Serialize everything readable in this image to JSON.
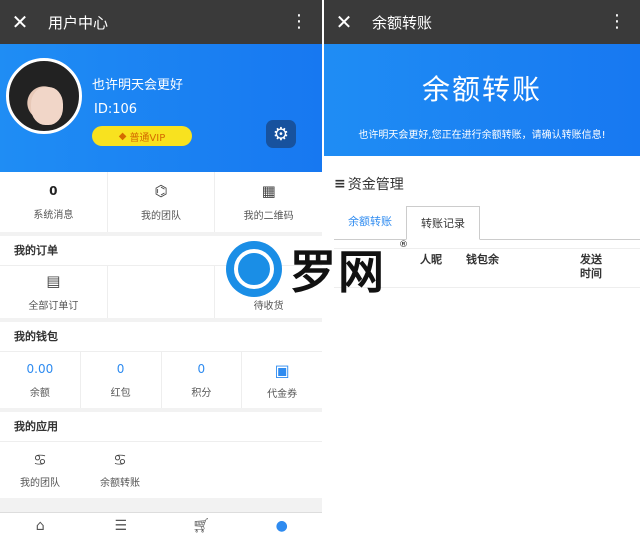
{
  "left": {
    "title": "用户中心",
    "profile": {
      "name": "也许明天会更好",
      "id": "ID:106",
      "vip": "普通VIP"
    },
    "stats": [
      {
        "value": "0",
        "label": "系统消息"
      },
      {
        "icon": "team-tree-icon",
        "label": "我的团队"
      },
      {
        "icon": "qrcode-icon",
        "label": "我的二维码"
      }
    ],
    "orders": {
      "title": "我的订单",
      "items": [
        "全部订单订",
        "",
        "待收货"
      ]
    },
    "wallet": {
      "title": "我的钱包",
      "items": [
        {
          "value": "0.00",
          "label": "余额"
        },
        {
          "value": "0",
          "label": "红包"
        },
        {
          "value": "0",
          "label": "积分"
        },
        {
          "icon": "voucher-icon",
          "label": "代金券"
        }
      ]
    },
    "apps": {
      "title": "我的应用",
      "items": [
        "我的团队",
        "余额转账"
      ]
    },
    "nav": [
      "home-icon",
      "list-icon",
      "cart-icon",
      "user-icon"
    ]
  },
  "right": {
    "title": "余额转账",
    "banner_title": "余额转账",
    "banner_sub": "也许明天会更好,您正在进行余额转账，请确认转账信息!",
    "section": "资金管理",
    "tabs": [
      "余额转账",
      "转账记录"
    ],
    "table_cols": [
      "人昵",
      "钱包余",
      "发送时间"
    ]
  },
  "watermark": {
    "text": "罗网",
    "mark": "®"
  },
  "colors": {
    "blue": "#1f8df4",
    "dark_bar": "#3a3a3a",
    "vip_yellow": "#f8e21f"
  }
}
